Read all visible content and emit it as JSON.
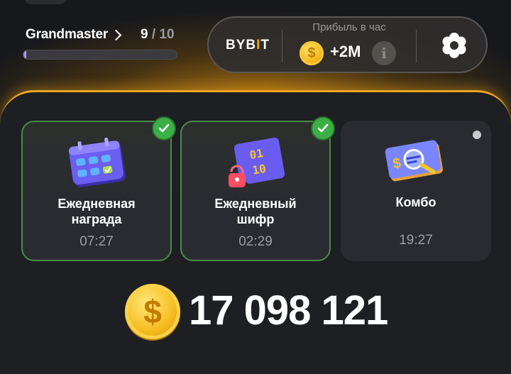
{
  "level": {
    "name": "Grandmaster",
    "current": "9",
    "separator": "/",
    "max": "10",
    "progress": 0.02
  },
  "exchange": {
    "name_pre": "BYB",
    "name_accent": "I",
    "name_post": "T"
  },
  "profit": {
    "label": "Прибыль в час",
    "value": "+2M",
    "info_symbol": "i"
  },
  "cards": [
    {
      "title": "Ежедневная\nнаграда",
      "time": "07:27",
      "completed": true,
      "icon": "calendar-icon"
    },
    {
      "title": "Ежедневный\nшифр",
      "time": "02:29",
      "completed": true,
      "icon": "cipher-lock-icon"
    },
    {
      "title": "Комбо",
      "time": "19:27",
      "completed": false,
      "icon": "combo-card-icon"
    }
  ],
  "balance": {
    "value": "17 098 121",
    "coin_symbol": "$"
  },
  "colors": {
    "accent": "#f0a620",
    "success": "#3cb046",
    "card_bg": "#2a2b30",
    "background": "#17181b"
  }
}
